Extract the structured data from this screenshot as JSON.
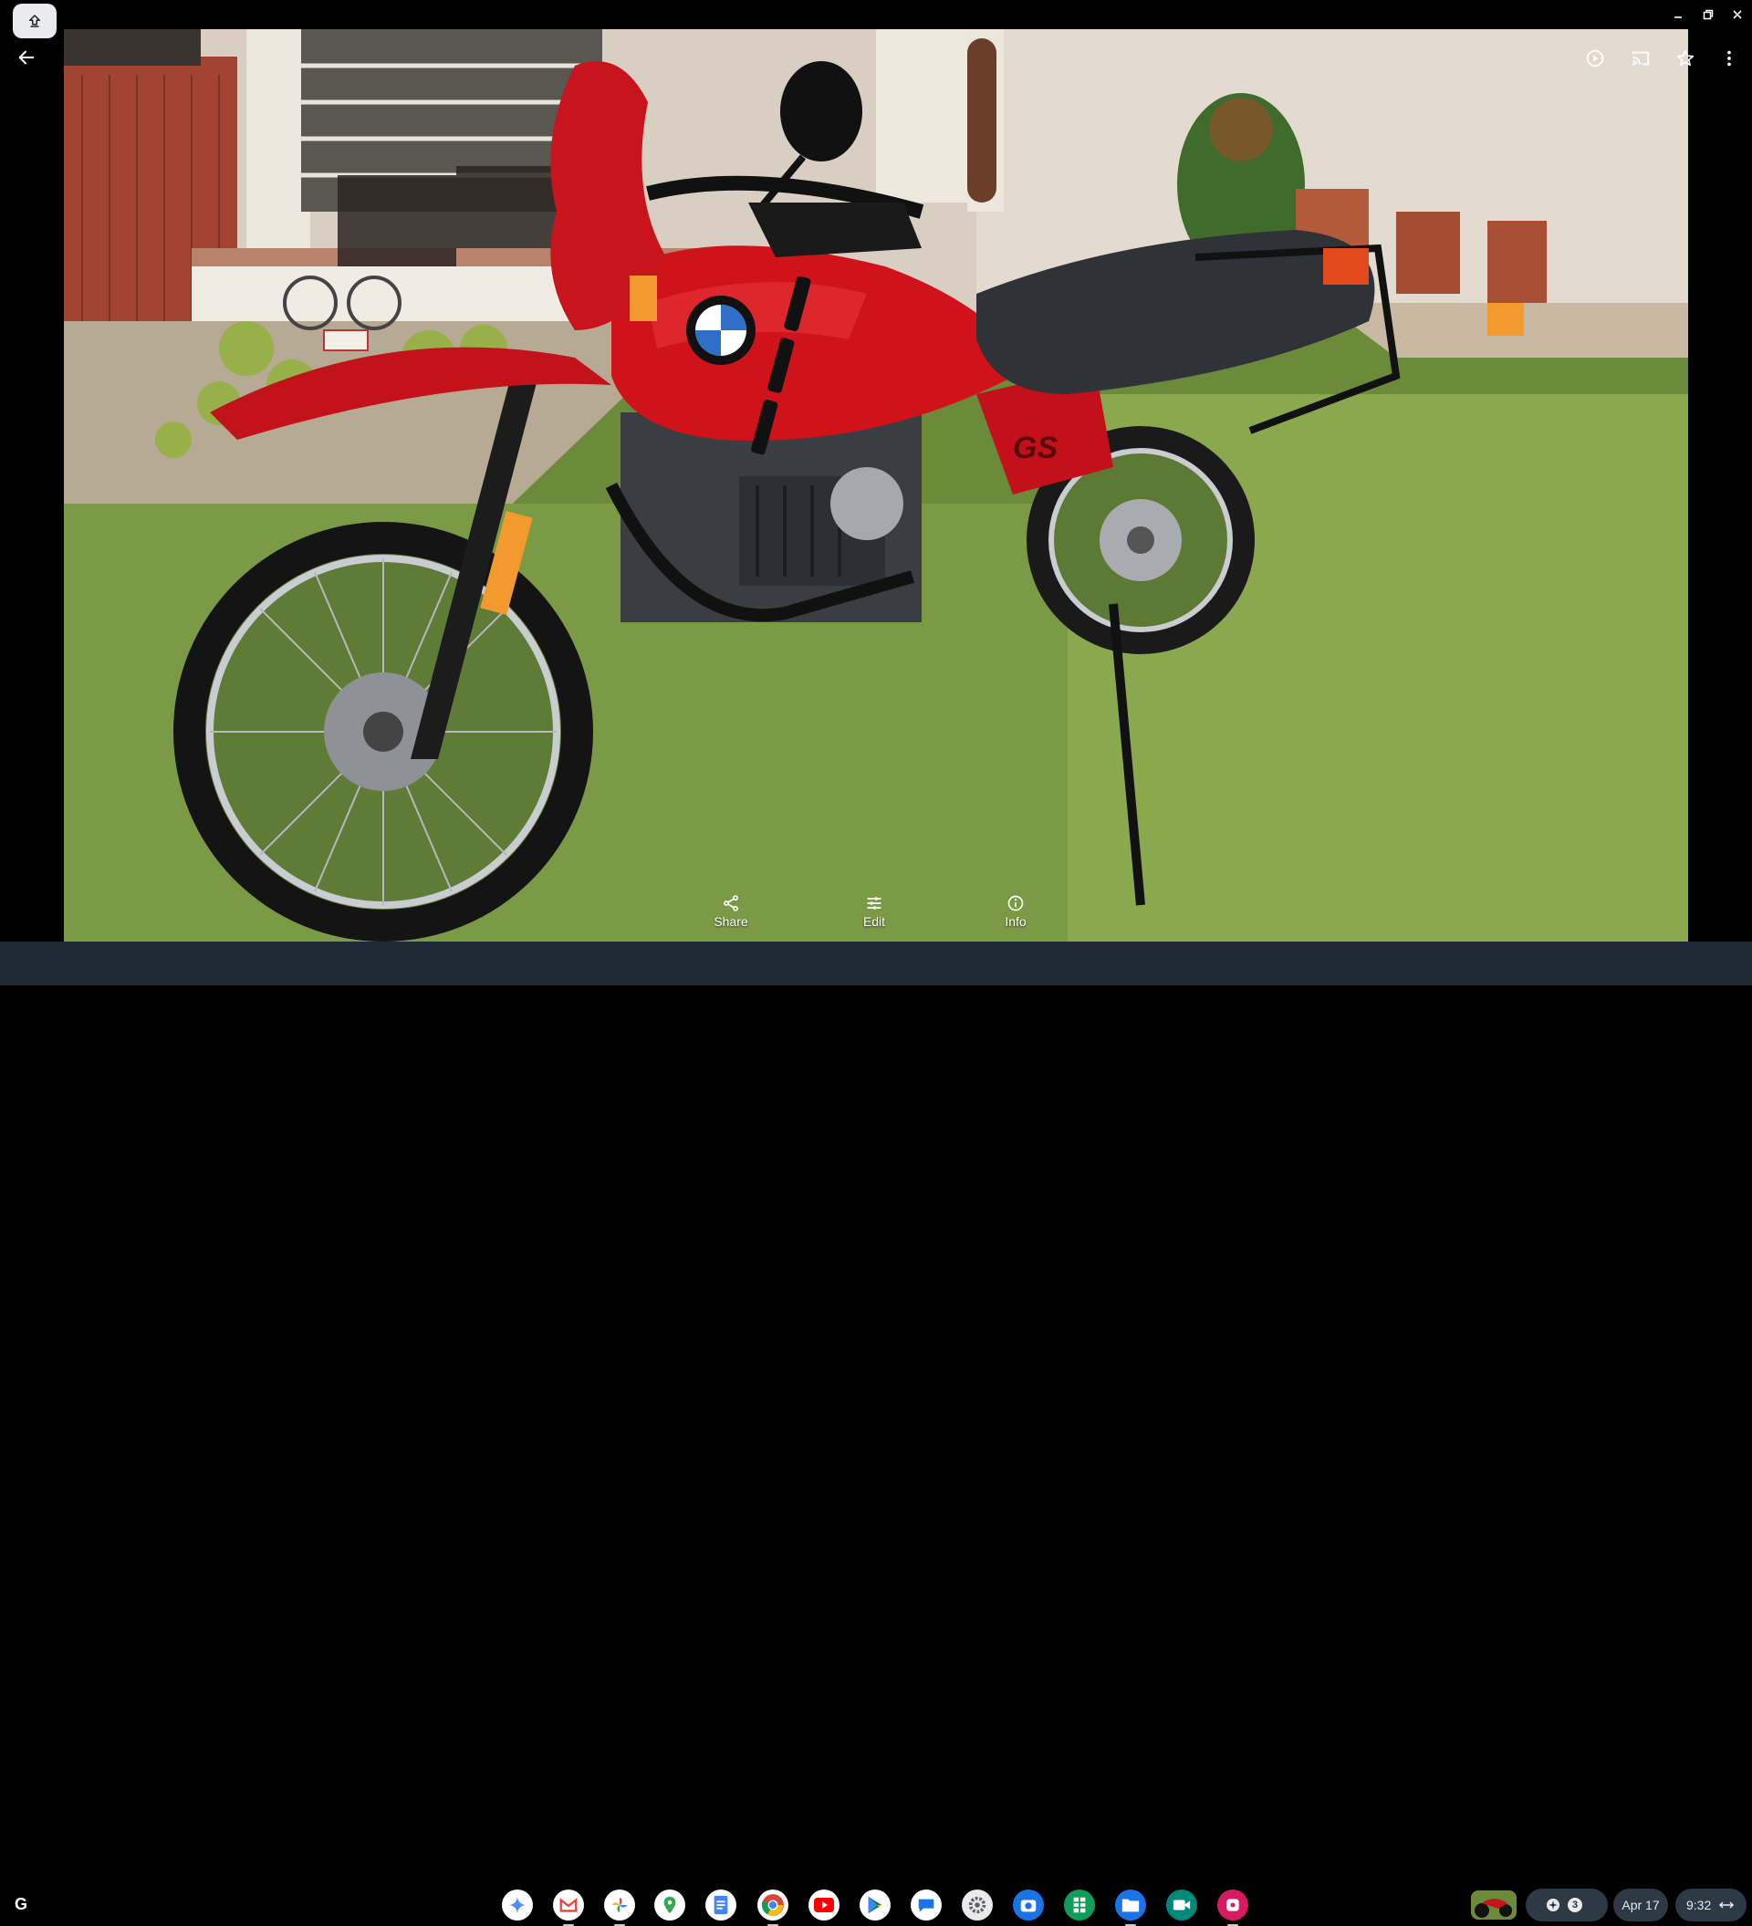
{
  "window": {
    "controls": [
      "minimize-icon",
      "restore-icon",
      "close-icon"
    ]
  },
  "viewer": {
    "toolbar_icons": [
      "slideshow-icon",
      "cast-icon",
      "star-icon",
      "more-icon"
    ],
    "actions": [
      {
        "label": "Share",
        "icon": "share-icon"
      },
      {
        "label": "Edit",
        "icon": "edit-sliders-icon"
      },
      {
        "label": "Info",
        "icon": "info-icon"
      }
    ]
  },
  "shelf": {
    "launcher_label": "G",
    "apps": [
      {
        "name": "gemini",
        "color": "#4c8df6"
      },
      {
        "name": "gmail",
        "color": "#ea4335"
      },
      {
        "name": "photos",
        "color": "#fbbc04"
      },
      {
        "name": "maps",
        "color": "#34a853"
      },
      {
        "name": "docs",
        "color": "#4285f4"
      },
      {
        "name": "chrome",
        "color": "#db4437"
      },
      {
        "name": "youtube",
        "color": "#ff0000"
      },
      {
        "name": "play-store",
        "color": "#01875f"
      },
      {
        "name": "messages",
        "color": "#1a73e8"
      },
      {
        "name": "settings",
        "color": "#5f6368"
      },
      {
        "name": "camera",
        "color": "#1a73e8"
      },
      {
        "name": "sheets",
        "color": "#0f9d58"
      },
      {
        "name": "files",
        "color": "#1a73e8"
      },
      {
        "name": "meet",
        "color": "#00897b"
      },
      {
        "name": "assistant",
        "color": "#d81b60"
      }
    ],
    "tray": {
      "notification_count": "3",
      "date": "Apr 17",
      "time": "9:32"
    }
  }
}
